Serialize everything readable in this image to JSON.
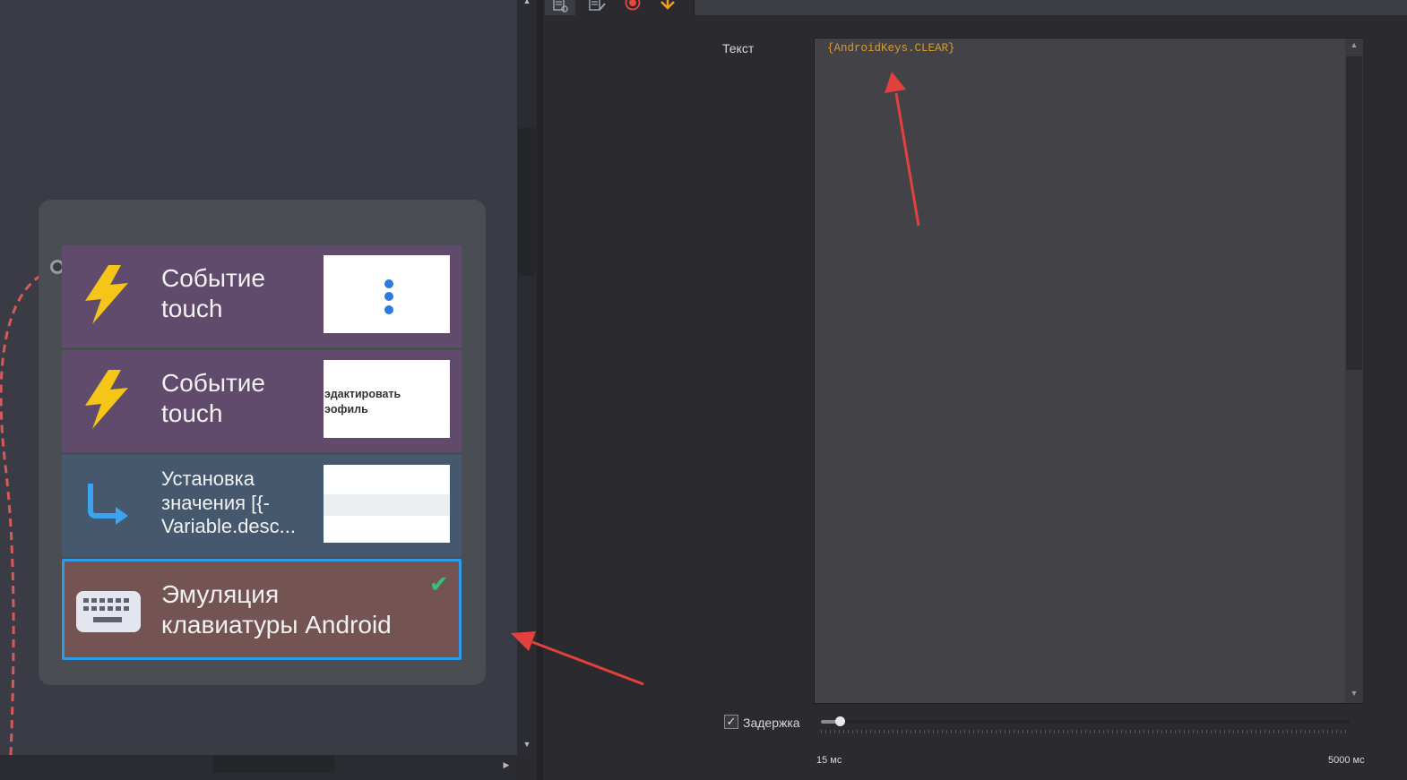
{
  "canvas": {
    "nodes": [
      {
        "title": "Событие\ntouch",
        "thumbnail": "menu-dots",
        "icon": "lightning-icon"
      },
      {
        "title": "Событие\ntouch",
        "thumbnail_text": "эдактировать\nэофиль",
        "icon": "lightning-icon"
      },
      {
        "title": "Установка\nзначения [{-\nVariable.desc...",
        "thumbnail": "input-field",
        "icon": "arrow-turn-icon"
      },
      {
        "title": "Эмуляция\nклавиатуры Android",
        "icon": "keyboard-icon",
        "selected": true,
        "status": "check-icon"
      }
    ]
  },
  "toolbar": {
    "icons": [
      "properties-icon",
      "edit-list-icon",
      "record-icon",
      "download-arrow-icon"
    ]
  },
  "properties": {
    "text_label": "Текст",
    "text_value": "{AndroidKeys.CLEAR}",
    "delay_label": "Задержка",
    "delay_checked": true,
    "delay_min_label": "15 мс",
    "delay_max_label": "5000 мс",
    "delay_slider_position": 0.035
  },
  "colors": {
    "accent": "#2e9be8",
    "code_text": "#d99a2e",
    "annotation_arrow": "#e2413d",
    "event_node": "#614b6d",
    "set_value_node": "#46586d",
    "keyboard_node": "#735453"
  }
}
